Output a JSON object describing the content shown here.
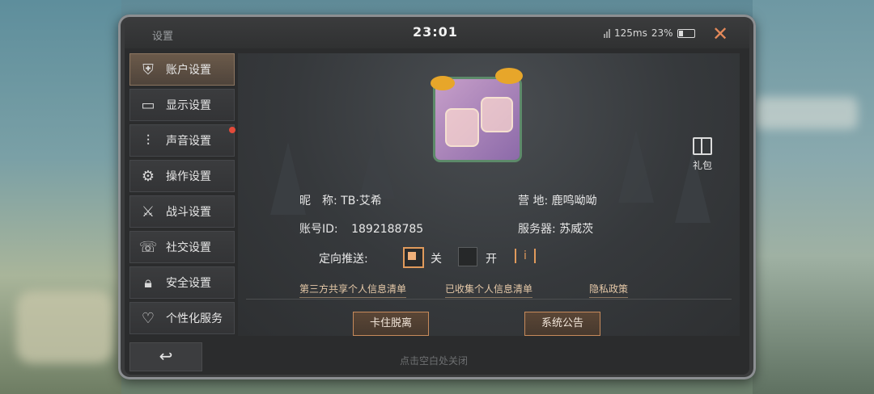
{
  "topbar": {
    "title": "设置",
    "time": "23:01",
    "ping": "125ms",
    "battery": "23%"
  },
  "sidebar": {
    "items": [
      {
        "label": "账户设置",
        "icon": "account-icon"
      },
      {
        "label": "显示设置",
        "icon": "display-icon"
      },
      {
        "label": "声音设置",
        "icon": "sound-icon"
      },
      {
        "label": "操作设置",
        "icon": "controls-icon"
      },
      {
        "label": "战斗设置",
        "icon": "combat-icon"
      },
      {
        "label": "社交设置",
        "icon": "social-icon"
      },
      {
        "label": "安全设置",
        "icon": "security-icon"
      },
      {
        "label": "个性化服务",
        "icon": "personalization-icon"
      }
    ]
  },
  "profile": {
    "nickname_label": "昵　称:",
    "nickname": "TB·艾希",
    "camp_label": "营  地:",
    "camp": "鹿鸣呦呦",
    "id_label": "账号ID:",
    "id": "1892188785",
    "server_label": "服务器:",
    "server": "苏威茨",
    "push_label": "定向推送:",
    "push_off": "关",
    "push_on": "开",
    "push_value": "off"
  },
  "gift": {
    "label": "礼包"
  },
  "links": {
    "third_party": "第三方共享个人信息清单",
    "collected": "已收集个人信息清单",
    "privacy": "隐私政策"
  },
  "buttons": {
    "stuck": "卡住脱离",
    "announcement": "系统公告"
  },
  "footer": {
    "hint": "点击空白处关闭"
  },
  "colors": {
    "accent": "#e09a5c",
    "active_tab": "#6b5a4a",
    "notification": "#e34b3a"
  }
}
